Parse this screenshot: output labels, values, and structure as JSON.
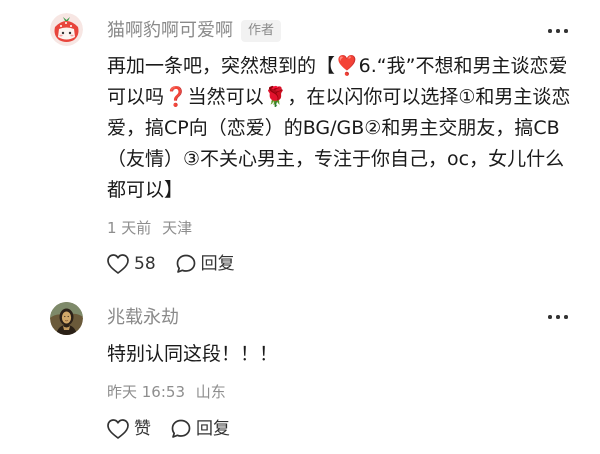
{
  "comments": [
    {
      "author": "猫啊豹啊可爱啊",
      "author_tag": "作者",
      "text": "再加一条吧，突然想到的【❣️6.“我”不想和男主谈恋爱可以吗❓当然可以🌹，在以闪你可以选择①和男主谈恋爱，搞CP向（恋爱）的BG/GB②和男主交朋友，搞CB（友情）③不关心男主，专注于你自己，oc，女儿什么都可以】",
      "time": "1 天前",
      "location": "天津",
      "like_label": "58",
      "reply_label": "回复",
      "avatar_icon": "strawberry-cat-avatar"
    },
    {
      "author": "兆载永劫",
      "text": "特别认同这段！！！",
      "time": "昨天 16:53",
      "location": "山东",
      "like_label": "赞",
      "reply_label": "回复",
      "avatar_icon": "portrait-avatar"
    }
  ],
  "icons": {
    "like": "heart-outline-icon",
    "reply": "speech-bubble-icon",
    "more": "more-dots-icon"
  },
  "colors": {
    "secondary_text": "#8a8a8a",
    "tag_background": "#f2f2f2",
    "body_text": "#1a1a1a"
  }
}
